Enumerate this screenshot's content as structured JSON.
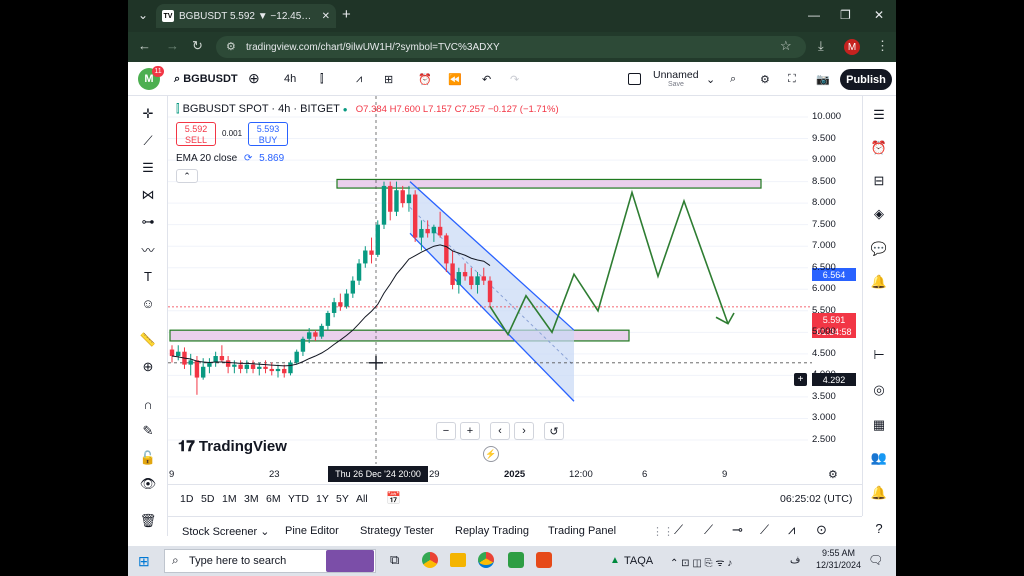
{
  "browser": {
    "tab_title": "BGBUSDT 5.592 ▼ −12.45% Un",
    "url": "tradingview.com/chart/9ilwUW1H/?symbol=TVC%3ADXY",
    "profile_initial": "M"
  },
  "toolbar": {
    "avatar_badge": "11",
    "symbol": "BGBUSDT",
    "interval": "4h",
    "layout_name": "Unnamed",
    "layout_sub": "Save",
    "publish_label": "Publish"
  },
  "legend": {
    "title": "BGBUSDT SPOT · 4h · BITGET",
    "ohlc": "O7.384 H7.600 L7.157 C7.257 −0.127 (−1.71%)",
    "sell_price": "5.592",
    "sell_label": "SELL",
    "spread": "0.001",
    "buy_price": "5.593",
    "buy_label": "BUY",
    "ema": "EMA 20 close",
    "ema_value": "5.869"
  },
  "price_labels": {
    "current": "5.591",
    "countdown": "01:34:58",
    "ema": "6.564",
    "crosshair": "4.292"
  },
  "chart_data": {
    "type": "candlestick",
    "y_ticks": [
      "10.000",
      "9.500",
      "9.000",
      "8.500",
      "8.000",
      "7.500",
      "7.000",
      "6.500",
      "6.000",
      "5.500",
      "5.000",
      "4.500",
      "4.000",
      "3.500",
      "3.000",
      "2.500"
    ],
    "x_ticks": [
      "9",
      "23",
      "29",
      "2025",
      "12:00",
      "6",
      "9"
    ],
    "crosshair_x_label": "Thu 26 Dec '24  20:00",
    "ohlc": [
      [
        4.6,
        4.7,
        4.3,
        4.45
      ],
      [
        4.45,
        4.7,
        4.35,
        4.55
      ],
      [
        4.55,
        4.65,
        4.15,
        4.25
      ],
      [
        4.25,
        4.5,
        4.0,
        4.35
      ],
      [
        4.35,
        4.45,
        3.55,
        3.95
      ],
      [
        3.95,
        4.4,
        3.9,
        4.2
      ],
      [
        4.2,
        4.4,
        4.05,
        4.3
      ],
      [
        4.3,
        4.55,
        4.2,
        4.45
      ],
      [
        4.45,
        4.7,
        4.3,
        4.35
      ],
      [
        4.35,
        4.45,
        4.05,
        4.2
      ],
      [
        4.2,
        4.35,
        4.05,
        4.25
      ],
      [
        4.25,
        4.35,
        4.05,
        4.15
      ],
      [
        4.15,
        4.35,
        4.05,
        4.25
      ],
      [
        4.25,
        4.35,
        4.05,
        4.15
      ],
      [
        4.15,
        4.3,
        4.0,
        4.2
      ],
      [
        4.2,
        4.35,
        4.05,
        4.15
      ],
      [
        4.15,
        4.3,
        4.0,
        4.1
      ],
      [
        4.1,
        4.25,
        3.95,
        4.15
      ],
      [
        4.15,
        4.25,
        3.95,
        4.05
      ],
      [
        4.05,
        4.35,
        4.0,
        4.3
      ],
      [
        4.3,
        4.6,
        4.25,
        4.55
      ],
      [
        4.55,
        4.9,
        4.45,
        4.85
      ],
      [
        4.85,
        5.1,
        4.75,
        5.0
      ],
      [
        5.0,
        5.05,
        4.8,
        4.9
      ],
      [
        4.9,
        5.2,
        4.85,
        5.15
      ],
      [
        5.15,
        5.5,
        5.05,
        5.45
      ],
      [
        5.45,
        5.8,
        5.35,
        5.7
      ],
      [
        5.7,
        5.9,
        5.5,
        5.6
      ],
      [
        5.6,
        6.0,
        5.55,
        5.9
      ],
      [
        5.9,
        6.3,
        5.8,
        6.2
      ],
      [
        6.2,
        6.7,
        6.1,
        6.6
      ],
      [
        6.6,
        7.0,
        6.5,
        6.9
      ],
      [
        6.9,
        7.2,
        6.6,
        6.8
      ],
      [
        6.8,
        7.6,
        6.75,
        7.5
      ],
      [
        7.5,
        8.5,
        7.4,
        8.4
      ],
      [
        8.4,
        8.5,
        7.6,
        7.8
      ],
      [
        7.8,
        8.5,
        7.7,
        8.3
      ],
      [
        8.3,
        8.4,
        7.9,
        8.0
      ],
      [
        8.0,
        8.4,
        7.8,
        8.2
      ],
      [
        8.2,
        8.3,
        7.1,
        7.2
      ],
      [
        7.2,
        7.6,
        6.9,
        7.4
      ],
      [
        7.4,
        7.6,
        7.2,
        7.3
      ],
      [
        7.3,
        7.5,
        7.1,
        7.45
      ],
      [
        7.45,
        7.8,
        7.2,
        7.25
      ],
      [
        7.25,
        7.3,
        6.4,
        6.6
      ],
      [
        6.6,
        6.9,
        6.0,
        6.1
      ],
      [
        6.1,
        6.5,
        5.9,
        6.4
      ],
      [
        6.4,
        6.6,
        6.2,
        6.3
      ],
      [
        6.3,
        6.5,
        6.0,
        6.1
      ],
      [
        6.1,
        6.4,
        5.9,
        6.3
      ],
      [
        6.3,
        6.5,
        6.1,
        6.2
      ],
      [
        6.2,
        6.3,
        5.6,
        5.7
      ]
    ],
    "ema": [
      4.45,
      4.43,
      4.4,
      4.38,
      4.33,
      4.31,
      4.3,
      4.31,
      4.31,
      4.3,
      4.29,
      4.28,
      4.28,
      4.27,
      4.26,
      4.25,
      4.24,
      4.23,
      4.22,
      4.23,
      4.26,
      4.32,
      4.39,
      4.45,
      4.52,
      4.61,
      4.72,
      4.82,
      4.93,
      5.05,
      5.2,
      5.36,
      5.49,
      5.65,
      5.91,
      6.12,
      6.35,
      6.52,
      6.7,
      6.78,
      6.86,
      6.93,
      7.0,
      7.03,
      6.99,
      6.89,
      6.84,
      6.79,
      6.72,
      6.68,
      6.65,
      6.55
    ],
    "zones": [
      {
        "from": 8.35,
        "to": 8.55
      },
      {
        "from": 4.8,
        "to": 5.05
      }
    ],
    "channel": {
      "upper": [
        8.5,
        5.05
      ],
      "lower": [
        7.3,
        3.4
      ]
    },
    "projection": [
      5.6,
      4.95,
      5.85,
      5.0,
      6.35,
      5.5,
      8.25,
      6.3,
      8.05,
      5.2
    ]
  },
  "periods": [
    "1D",
    "5D",
    "1M",
    "3M",
    "6M",
    "YTD",
    "1Y",
    "5Y",
    "All"
  ],
  "clock": "06:25:02 (UTC)",
  "watermark": "TradingView",
  "bottom_tabs": [
    "Stock Screener",
    "Pine Editor",
    "Strategy Tester",
    "Replay Trading",
    "Trading Panel"
  ],
  "taskbar": {
    "search_placeholder": "Type here to search",
    "ticker": "TAQA",
    "lang": "ف",
    "time": "9:55 AM",
    "date": "12/31/2024"
  },
  "colors": {
    "up": "#089981",
    "down": "#f23645",
    "zone_fill": "#ead0ec",
    "zone_border": "#1f7a1f",
    "channel_fill": "#c7d8f5",
    "channel_border": "#2962ff",
    "projection": "#2e7d32",
    "price_tag": "#f23645"
  }
}
